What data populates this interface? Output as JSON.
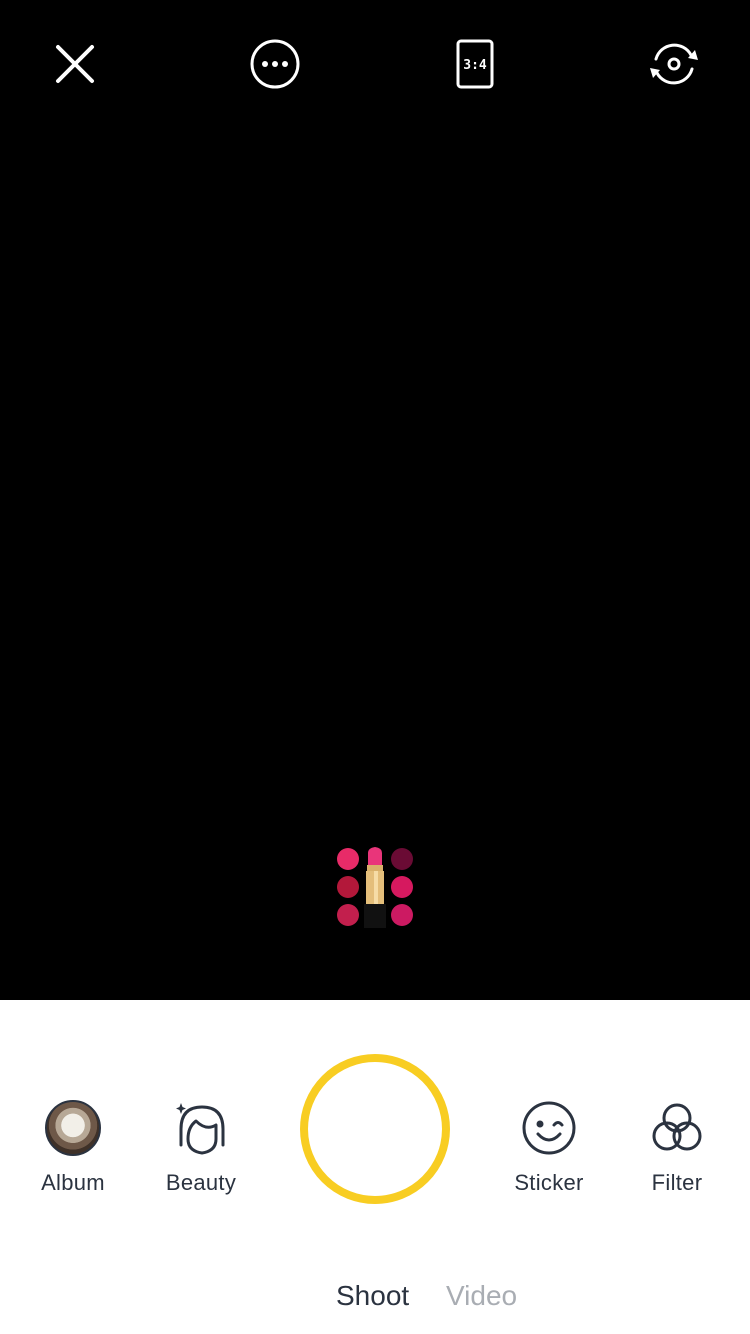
{
  "top_bar": {
    "close_icon": "close-icon",
    "more_icon": "more-options-icon",
    "aspect_ratio": "3:4",
    "flip_icon": "switch-camera-icon"
  },
  "effect": {
    "icon": "lipstick-makeup-effect-icon",
    "colors": [
      "#e82b68",
      "#c8105c",
      "#6a0b34",
      "#b3183a",
      "#d6195f",
      "#c21f4d",
      "#cc1a62"
    ]
  },
  "tools": {
    "album": {
      "label": "Album",
      "icon": "album-thumbnail"
    },
    "beauty": {
      "label": "Beauty",
      "icon": "beauty-face-icon"
    },
    "sticker": {
      "label": "Sticker",
      "icon": "wink-face-icon"
    },
    "filter": {
      "label": "Filter",
      "icon": "filter-circles-icon"
    }
  },
  "shutter": {
    "icon": "shutter-button",
    "accent": "#f8cd22"
  },
  "modes": {
    "shoot": "Shoot",
    "video": "Video",
    "active": "Shoot"
  },
  "colors": {
    "viewfinder": "#000000",
    "panel": "#ffffff",
    "text": "#2b3340",
    "inactive_text": "#a9adb3"
  }
}
